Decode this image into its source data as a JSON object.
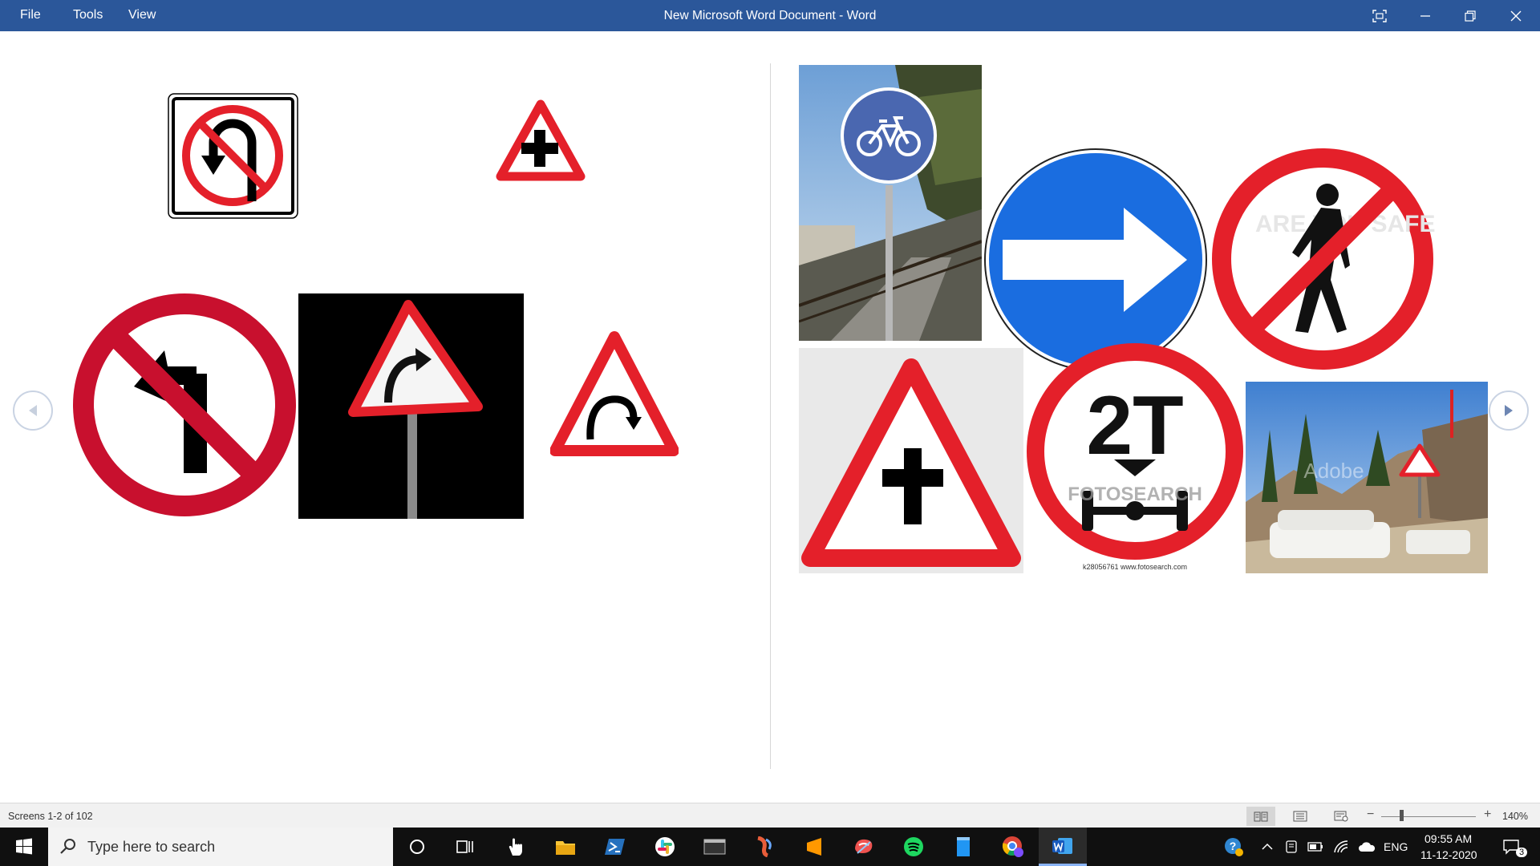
{
  "titlebar": {
    "menu": [
      "File",
      "Tools",
      "View"
    ],
    "title": "New Microsoft Word Document  -  Word"
  },
  "reading": {
    "left_images": [
      "no-u-turn-sign",
      "crossroads-warning-sign",
      "no-left-turn-sign",
      "right-bend-warning-post-sign",
      "right-bend-warning-sign"
    ],
    "right_images": [
      "bicycle-lane-sign-photo",
      "keep-right-arrow-sign",
      "no-pedestrians-sign",
      "crossroads-warning-sign-large",
      "2t-axle-load-limit-sign",
      "falling-rocks-sign-photo"
    ],
    "watermark_fotosearch": "FOTOSEARCH",
    "caption_fotosearch": "k28056761  www.fotosearch.com",
    "sign_2t_text": "2T",
    "pedestrian_sign_text": "ARE YOU SAFE?",
    "adobe_watermark": "Adobe"
  },
  "statusbar": {
    "screens": "Screens 1-2 of 102",
    "zoom": "140%"
  },
  "taskbar": {
    "search_placeholder": "Type here to search",
    "tray": {
      "language": "ENG",
      "time": "09:55 AM",
      "date": "11-12-2020",
      "notifications": "3"
    }
  }
}
